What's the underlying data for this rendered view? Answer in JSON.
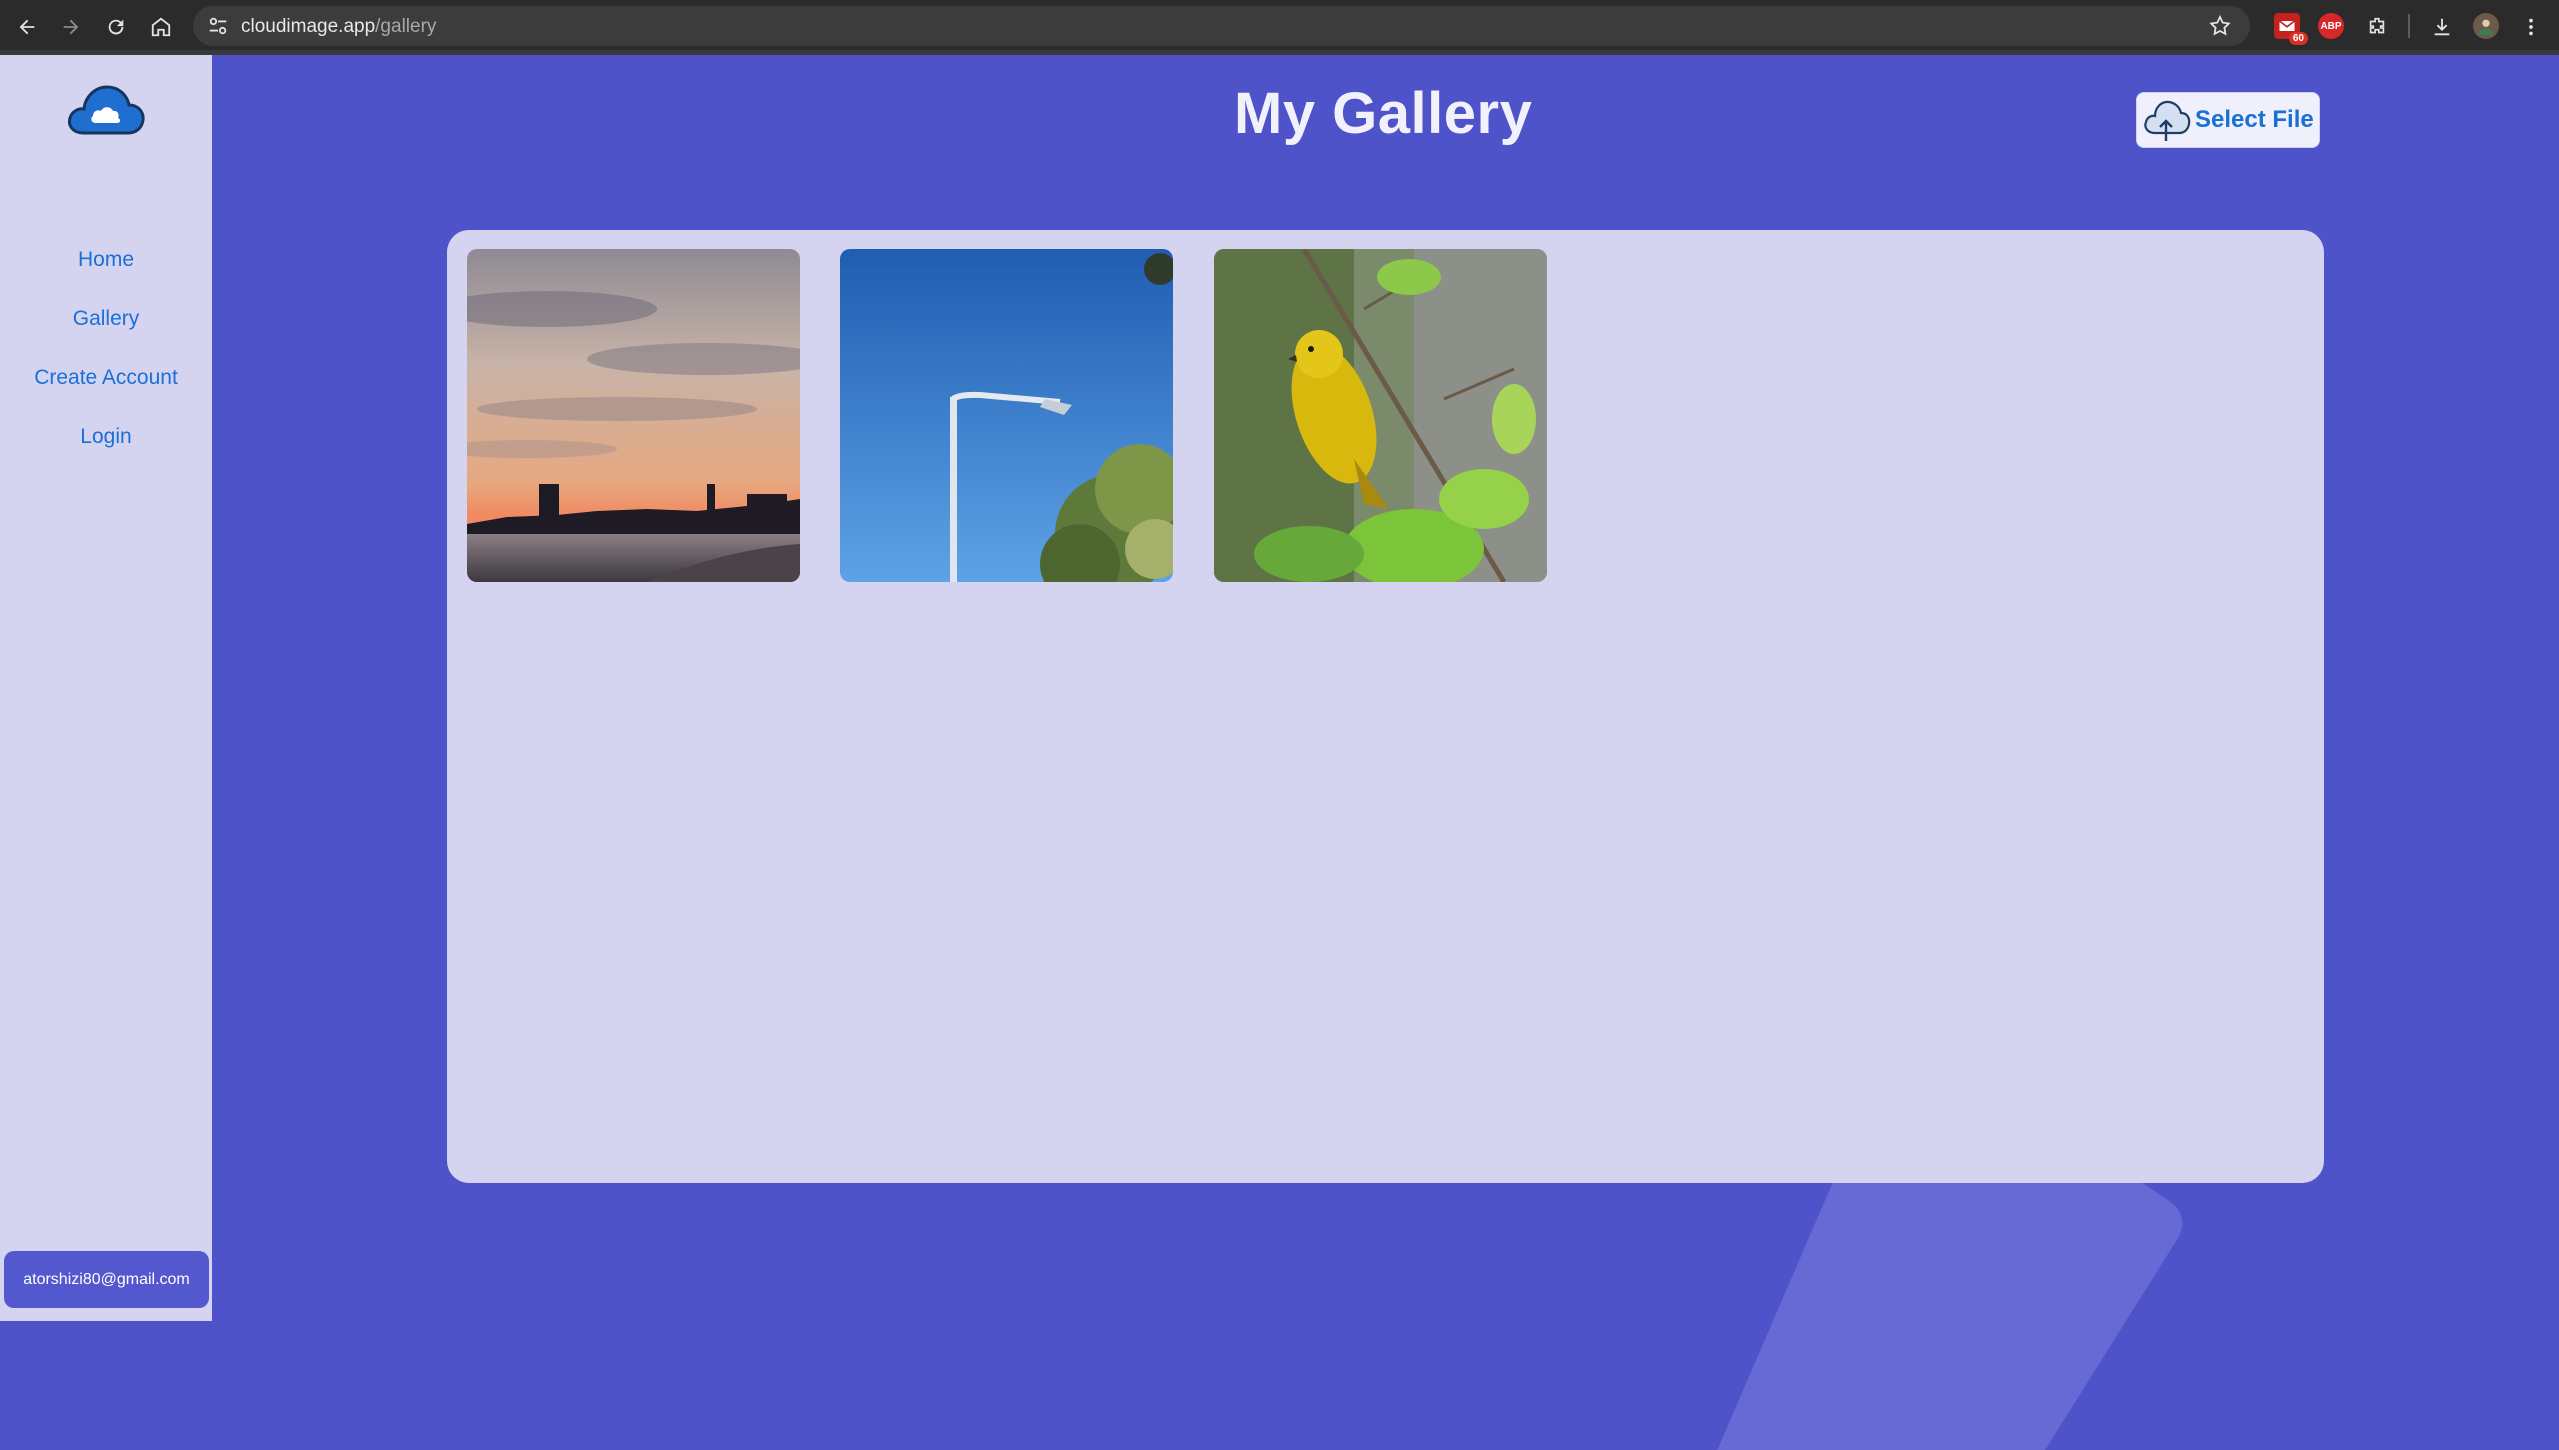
{
  "browser": {
    "url_host": "cloudimage.app",
    "url_path": "/gallery",
    "icons": [
      "back-icon",
      "forward-icon",
      "reload-icon",
      "home-icon",
      "site-info-icon",
      "bookmark-star-icon",
      "mail-extension-icon",
      "adblock-extension-icon",
      "extensions-puzzle-icon",
      "downloads-icon",
      "profile-avatar",
      "more-menu-icon"
    ],
    "mail_badge": "60",
    "adblock_label": "ABP"
  },
  "sidebar": {
    "logo": "cloud-logo-icon",
    "items": [
      {
        "label": "Home"
      },
      {
        "label": "Gallery"
      },
      {
        "label": "Create Account"
      },
      {
        "label": "Login"
      }
    ],
    "user_email": "atorshizi80@gmail.com"
  },
  "header": {
    "title": "My Gallery",
    "select_file_label": "Select File",
    "select_file_icon": "cloud-upload-icon"
  },
  "gallery": {
    "images": [
      {
        "subject": "sunset-beach-image"
      },
      {
        "subject": "street-lamp-image"
      },
      {
        "subject": "yellow-bird-image"
      }
    ]
  },
  "colors": {
    "background": "#4f53c9",
    "sidebar": "#d4d4f1",
    "panel": "#d4d4f1",
    "link": "#1b6fd6",
    "user_chip": "#5458cf"
  }
}
